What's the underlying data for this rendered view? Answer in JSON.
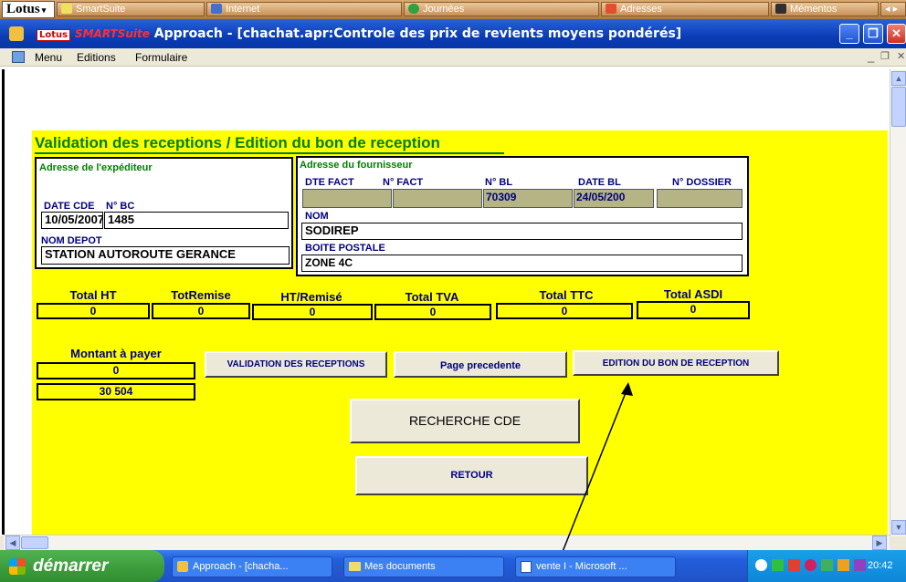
{
  "smartsuite_bar": {
    "lotus_label": "Lotus",
    "items": [
      "SmartSuite",
      "Internet",
      "Journées",
      "Adresses",
      "Mémentos"
    ]
  },
  "window": {
    "logo_lotus": "Lotus",
    "logo_suite": "SMARTSuite",
    "title": "Approach - [chachat.apr:Controle des prix de revients moyens pondérés]"
  },
  "menubar": {
    "items": [
      "Menu",
      "Editions",
      "Formulaire"
    ]
  },
  "form": {
    "title": "Validation des receptions / Edition du bon de reception",
    "sender": {
      "heading": "Adresse de l'expéditeur",
      "date_cde_label": "DATE CDE",
      "date_cde": "10/05/2007",
      "nbc_label": "N° BC",
      "nbc": "1485",
      "nom_depot_label": "NOM DEPOT",
      "nom_depot": "STATION AUTOROUTE GERANCE"
    },
    "supplier": {
      "heading": "Adresse du fournisseur",
      "dte_fact_label": "DTE FACT",
      "dte_fact": "",
      "n_fact_label": "N° FACT",
      "n_fact": "",
      "n_bl_label": "N° BL",
      "n_bl": "70309",
      "date_bl_label": "DATE BL",
      "date_bl": "24/05/200",
      "n_dossier_label": "N° DOSSIER",
      "n_dossier": "",
      "nom_label": "NOM",
      "nom": "SODIREP",
      "bp_label": "BOITE POSTALE",
      "bp": "ZONE 4C"
    },
    "totals": [
      {
        "label": "Total HT",
        "value": "0"
      },
      {
        "label": "TotRemise",
        "value": "0"
      },
      {
        "label": "HT/Remisé",
        "value": "0"
      },
      {
        "label": "Total TVA",
        "value": "0"
      },
      {
        "label": "Total TTC",
        "value": "0"
      },
      {
        "label": "Total ASDI",
        "value": "0"
      }
    ],
    "montant": {
      "label": "Montant à payer",
      "value": "0",
      "value2": "30 504"
    },
    "buttons": {
      "validation": "VALIDATION DES RECEPTIONS",
      "page_precedente": "Page precedente",
      "edition": "EDITION DU BON DE RECEPTION",
      "recherche": "RECHERCHE CDE",
      "retour": "RETOUR"
    }
  },
  "taskbar": {
    "start": "démarrer",
    "tasks": [
      "Approach - [chacha...",
      "Mes documents",
      "vente I - Microsoft ..."
    ],
    "clock": "20:42"
  },
  "colors": {
    "form_bg": "#ffff00",
    "form_title": "#008000",
    "field_label": "#000080",
    "titlebar": "#0a3cb6"
  }
}
